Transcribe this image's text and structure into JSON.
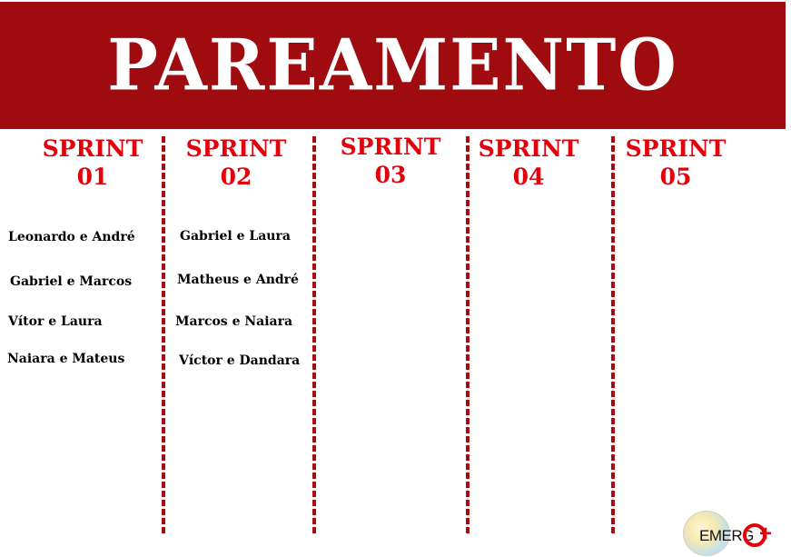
{
  "header": {
    "title": "PAREAMENTO"
  },
  "sprints": [
    {
      "label": "SPRINT",
      "number": "01",
      "pairs": [
        "Leonardo e André",
        "Gabriel e Marcos",
        "Vítor e Laura",
        "Naiara e Mateus"
      ]
    },
    {
      "label": "SPRINT",
      "number": "02",
      "pairs": [
        "Gabriel e Laura",
        "Matheus e André",
        "Marcos e Naiara",
        "Víctor e Dandara"
      ]
    },
    {
      "label": "SPRINT",
      "number": "03",
      "pairs": []
    },
    {
      "label": "SPRINT",
      "number": "04",
      "pairs": []
    },
    {
      "label": "SPRINT",
      "number": "05",
      "pairs": []
    }
  ],
  "logo": {
    "text": "EMERG"
  },
  "colors": {
    "banner": "#a00b0f",
    "heading": "#e3000b",
    "divider": "#a50d12"
  }
}
